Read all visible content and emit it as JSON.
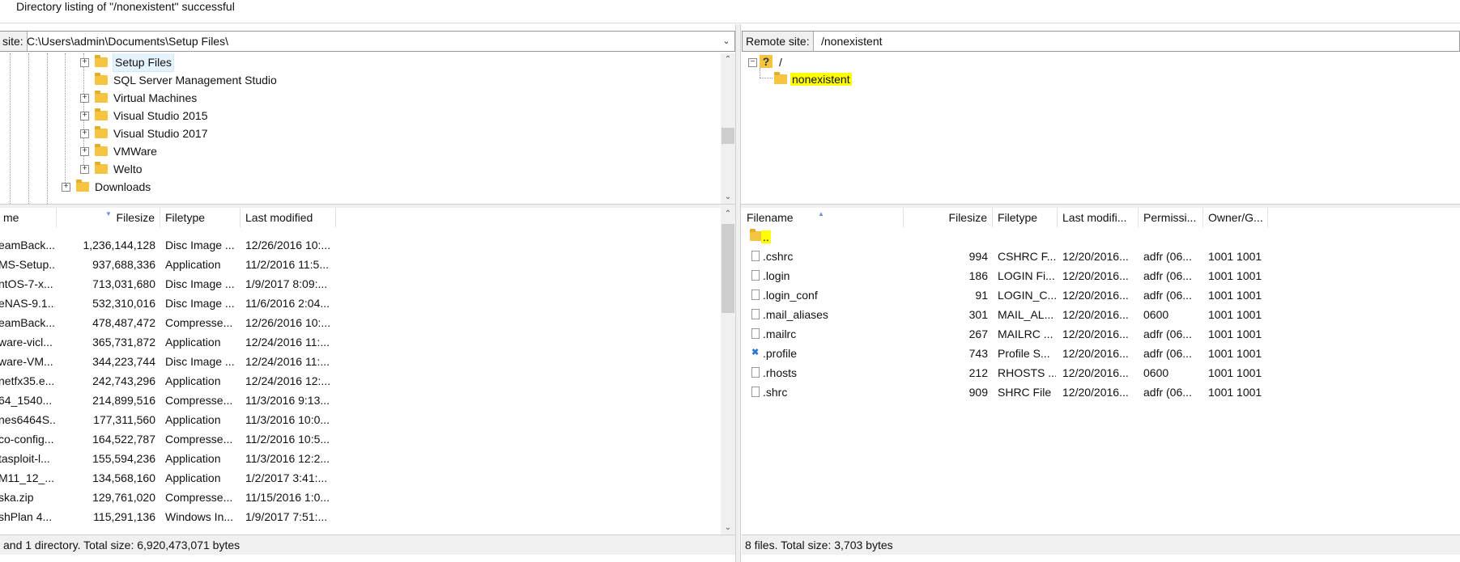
{
  "status_message": "Directory listing of \"/nonexistent\" successful",
  "local": {
    "site_label": "site:",
    "site_path": "C:\\Users\\admin\\Documents\\Setup Files\\",
    "tree": [
      {
        "label": "Setup Files",
        "selected": true
      },
      {
        "label": "SQL Server Management Studio"
      },
      {
        "label": "Virtual Machines"
      },
      {
        "label": "Visual Studio 2015"
      },
      {
        "label": "Visual Studio 2017"
      },
      {
        "label": "VMWare"
      },
      {
        "label": "Welto"
      },
      {
        "label": "Downloads"
      }
    ],
    "columns": [
      "me",
      "Filesize",
      "Filetype",
      "Last modified"
    ],
    "files": [
      {
        "name": "eamBack...",
        "size": "1,236,144,128",
        "type": "Disc Image ...",
        "modified": "12/26/2016 10:..."
      },
      {
        "name": "MS-Setup...",
        "size": "937,688,336",
        "type": "Application",
        "modified": "11/2/2016 11:5..."
      },
      {
        "name": "ntOS-7-x...",
        "size": "713,031,680",
        "type": "Disc Image ...",
        "modified": "1/9/2017 8:09:..."
      },
      {
        "name": "eNAS-9.1...",
        "size": "532,310,016",
        "type": "Disc Image ...",
        "modified": "11/6/2016 2:04..."
      },
      {
        "name": "eamBack...",
        "size": "478,487,472",
        "type": "Compresse...",
        "modified": "12/26/2016 10:..."
      },
      {
        "name": "ware-vicl...",
        "size": "365,731,872",
        "type": "Application",
        "modified": "12/24/2016 11:..."
      },
      {
        "name": "ware-VM...",
        "size": "344,223,744",
        "type": "Disc Image ...",
        "modified": "12/24/2016 11:..."
      },
      {
        "name": "netfx35.e...",
        "size": "242,743,296",
        "type": "Application",
        "modified": "12/24/2016 12:..."
      },
      {
        "name": "64_1540...",
        "size": "214,899,516",
        "type": "Compresse...",
        "modified": "11/3/2016 9:13..."
      },
      {
        "name": "nes6464S...",
        "size": "177,311,560",
        "type": "Application",
        "modified": "11/3/2016 10:0..."
      },
      {
        "name": "co-config...",
        "size": "164,522,787",
        "type": "Compresse...",
        "modified": "11/2/2016 10:5..."
      },
      {
        "name": "tasploit-l...",
        "size": "155,594,236",
        "type": "Application",
        "modified": "11/3/2016 12:2..."
      },
      {
        "name": "M11_12_...",
        "size": "134,568,160",
        "type": "Application",
        "modified": "1/2/2017 3:41:..."
      },
      {
        "name": "ska.zip",
        "size": "129,761,020",
        "type": "Compresse...",
        "modified": "11/15/2016 1:0..."
      },
      {
        "name": "shPlan 4...",
        "size": "115,291,136",
        "type": "Windows In...",
        "modified": "1/9/2017 7:51:..."
      }
    ],
    "footer": "and 1 directory. Total size: 6,920,473,071 bytes"
  },
  "remote": {
    "site_label": "Remote site:",
    "site_path": "/nonexistent",
    "tree_root": "/",
    "tree_child": "nonexistent",
    "columns": [
      "Filename",
      "Filesize",
      "Filetype",
      "Last modifi...",
      "Permissi...",
      "Owner/G..."
    ],
    "parent_entry": "..",
    "files": [
      {
        "name": ".cshrc",
        "size": "994",
        "type": "CSHRC F...",
        "modified": "12/20/2016...",
        "perm": "adfr (06...",
        "owner": "1001 1001",
        "icon": "file-icon"
      },
      {
        "name": ".login",
        "size": "186",
        "type": "LOGIN Fi...",
        "modified": "12/20/2016...",
        "perm": "adfr (06...",
        "owner": "1001 1001",
        "icon": "file-icon"
      },
      {
        "name": ".login_conf",
        "size": "91",
        "type": "LOGIN_C...",
        "modified": "12/20/2016...",
        "perm": "adfr (06...",
        "owner": "1001 1001",
        "icon": "file-icon"
      },
      {
        "name": ".mail_aliases",
        "size": "301",
        "type": "MAIL_AL...",
        "modified": "12/20/2016...",
        "perm": "0600",
        "owner": "1001 1001",
        "icon": "file-icon"
      },
      {
        "name": ".mailrc",
        "size": "267",
        "type": "MAILRC ...",
        "modified": "12/20/2016...",
        "perm": "adfr (06...",
        "owner": "1001 1001",
        "icon": "file-icon"
      },
      {
        "name": ".profile",
        "size": "743",
        "type": "Profile S...",
        "modified": "12/20/2016...",
        "perm": "adfr (06...",
        "owner": "1001 1001",
        "icon": "vscode-icon"
      },
      {
        "name": ".rhosts",
        "size": "212",
        "type": "RHOSTS ...",
        "modified": "12/20/2016...",
        "perm": "0600",
        "owner": "1001 1001",
        "icon": "file-icon"
      },
      {
        "name": ".shrc",
        "size": "909",
        "type": "SHRC File",
        "modified": "12/20/2016...",
        "perm": "adfr (06...",
        "owner": "1001 1001",
        "icon": "file-icon"
      }
    ],
    "footer": "8 files. Total size: 3,703 bytes"
  },
  "colors": {
    "highlight": "#ffff00",
    "folder": "#f5c542"
  }
}
